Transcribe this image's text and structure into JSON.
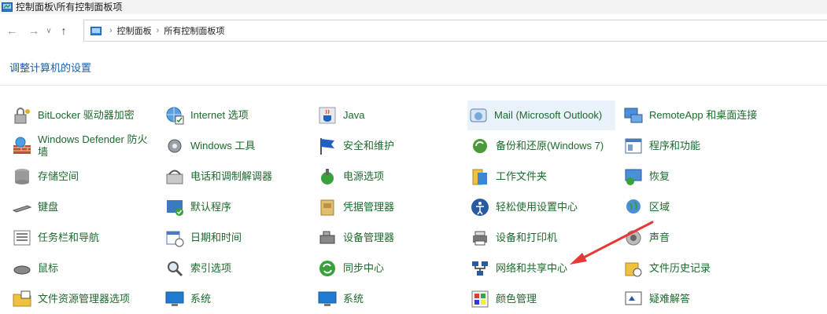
{
  "window": {
    "title": "控制面板\\所有控制面板项"
  },
  "address": {
    "crumbs": [
      "控制面板",
      "所有控制面板项"
    ]
  },
  "heading": "调整计算机的设置",
  "items": [
    [
      "BitLocker 驱动器加密",
      "Internet 选项",
      "Java",
      "Mail (Microsoft Outlook)",
      "RemoteApp 和桌面连接"
    ],
    [
      "Windows Defender 防火墙",
      "Windows 工具",
      "安全和维护",
      "备份和还原(Windows 7)",
      "程序和功能"
    ],
    [
      "存储空间",
      "电话和调制解调器",
      "电源选项",
      "工作文件夹",
      "恢复"
    ],
    [
      "键盘",
      "默认程序",
      "凭据管理器",
      "轻松使用设置中心",
      "区域"
    ],
    [
      "任务栏和导航",
      "日期和时间",
      "设备管理器",
      "设备和打印机",
      "声音"
    ],
    [
      "鼠标",
      "索引选项",
      "同步中心",
      "网络和共享中心",
      "文件历史记录"
    ],
    [
      "文件资源管理器选项",
      "系统",
      "系统",
      "颜色管理",
      "疑难解答"
    ]
  ],
  "colors": {
    "link": "#1b6a2c",
    "heading": "#1a5fa8",
    "annotation": "#e53935",
    "highlight": "#e9f1fb"
  }
}
